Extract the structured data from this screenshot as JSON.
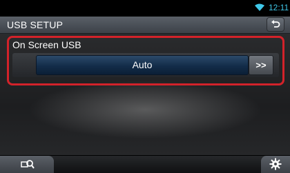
{
  "status_bar": {
    "time": "12:11",
    "icon": "wifi-icon"
  },
  "header": {
    "title": "USB SETUP",
    "back_icon": "back-arrow-icon"
  },
  "setting": {
    "label": "On Screen USB",
    "value": "Auto",
    "next_label": ">>"
  },
  "bottom_bar": {
    "left_icon": "search-device-icon",
    "right_icon": "gear-icon"
  },
  "colors": {
    "highlight_border": "#d3222a",
    "clock": "#3fc7e8",
    "value_button": "#132c49"
  }
}
